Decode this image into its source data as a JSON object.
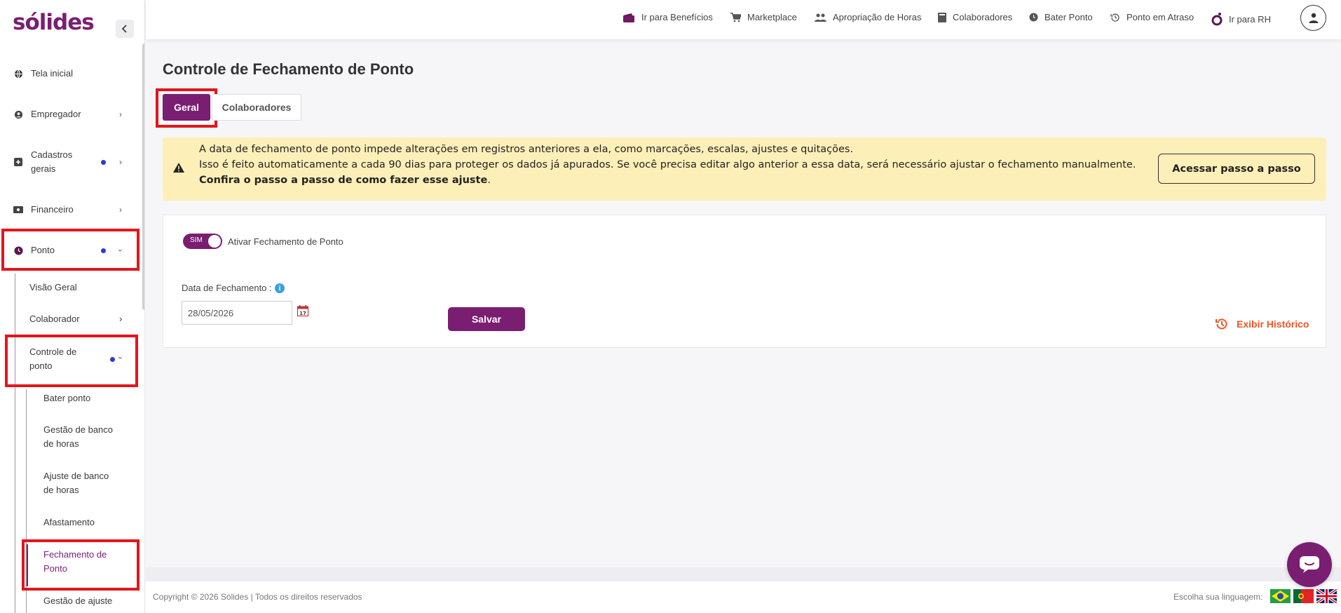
{
  "brand": {
    "logo": "sólides",
    "accent": "#7a1e72",
    "highlight": "#e4151b",
    "warning_bg": "#fdefb8",
    "link_color": "#f05523"
  },
  "sidebar": {
    "items": [
      {
        "label": "Tela inicial",
        "icon": "globe-icon"
      },
      {
        "label": "Empregador",
        "icon": "user-circle-icon"
      },
      {
        "label": "Cadastros gerais",
        "icon": "plus-square-icon"
      },
      {
        "label": "Financeiro",
        "icon": "money-icon"
      },
      {
        "label": "Ponto",
        "icon": "clock-icon"
      }
    ],
    "ponto_sub": [
      {
        "label": "Visão Geral"
      },
      {
        "label": "Colaborador"
      },
      {
        "label": "Controle de ponto"
      }
    ],
    "controle_sub": [
      {
        "label": "Bater ponto"
      },
      {
        "label": "Gestão de banco de horas"
      },
      {
        "label": "Ajuste de banco de horas"
      },
      {
        "label": "Afastamento"
      },
      {
        "label": "Fechamento de Ponto"
      },
      {
        "label": "Gestão de ajuste"
      }
    ]
  },
  "topnav": [
    {
      "label": "Ir para Benefícios",
      "icon": "wallet-icon"
    },
    {
      "label": "Marketplace",
      "icon": "cart-icon"
    },
    {
      "label": "Apropriação de Horas",
      "icon": "people-icon"
    },
    {
      "label": "Colaboradores",
      "icon": "book-icon"
    },
    {
      "label": "Bater Ponto",
      "icon": "clock-icon"
    },
    {
      "label": "Ponto em Atraso",
      "icon": "history-icon"
    },
    {
      "label": "Ir para RH",
      "icon": "solides-o-icon"
    }
  ],
  "main": {
    "title": "Controle de Fechamento de Ponto",
    "tabs": [
      {
        "label": "Geral"
      },
      {
        "label": "Colaboradores"
      }
    ],
    "alert": {
      "line1": "A data de fechamento de ponto impede alterações em registros anteriores a ela, como marcações, escalas, ajustes e quitações.",
      "line2": "Isso é feito automaticamente a cada 90 dias para proteger os dados já apurados. Se você precisa editar algo anterior a essa data, será necessário ajustar o fechamento manualmente.",
      "line3_bold": "Confira o passo a passo de como fazer esse ajuste",
      "line3_end": ".",
      "button": "Acessar passo a passo"
    },
    "toggle": {
      "state_label": "SIM",
      "label": "Ativar Fechamento de Ponto"
    },
    "date_label": "Data de Fechamento :",
    "date_value": "28/05/2026",
    "save_label": "Salvar",
    "history_label": "Exibir Histórico"
  },
  "footer": {
    "copyright": "Copyright © 2026 Sólides | Todos os direitos reservados",
    "language_label": "Escolha sua linguagem:"
  }
}
